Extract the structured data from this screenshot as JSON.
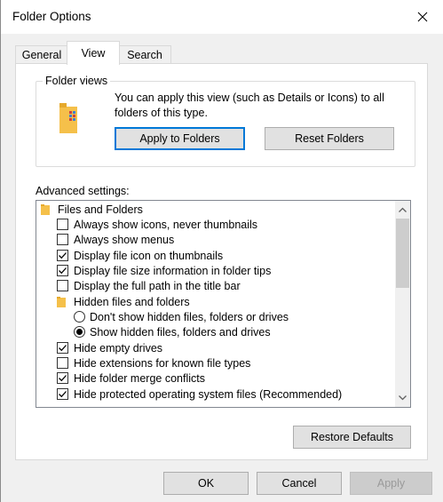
{
  "window": {
    "title": "Folder Options"
  },
  "tabs": [
    {
      "label": "General"
    },
    {
      "label": "View"
    },
    {
      "label": "Search"
    }
  ],
  "folder_views": {
    "label": "Folder views",
    "description": "You can apply this view (such as Details or Icons) to all folders of this type.",
    "apply_button": "Apply to Folders",
    "reset_button": "Reset Folders"
  },
  "advanced": {
    "label": "Advanced settings:",
    "items": [
      {
        "type": "folder",
        "label": "Files and Folders"
      },
      {
        "type": "checkbox",
        "label": "Always show icons, never thumbnails",
        "checked": false
      },
      {
        "type": "checkbox",
        "label": "Always show menus",
        "checked": false
      },
      {
        "type": "checkbox",
        "label": "Display file icon on thumbnails",
        "checked": true
      },
      {
        "type": "checkbox",
        "label": "Display file size information in folder tips",
        "checked": true
      },
      {
        "type": "checkbox",
        "label": "Display the full path in the title bar",
        "checked": false
      },
      {
        "type": "folder",
        "label": "Hidden files and folders"
      },
      {
        "type": "radio",
        "label": "Don't show hidden files, folders or drives",
        "checked": false
      },
      {
        "type": "radio",
        "label": "Show hidden files, folders and drives",
        "checked": true
      },
      {
        "type": "checkbox",
        "label": "Hide empty drives",
        "checked": true
      },
      {
        "type": "checkbox",
        "label": "Hide extensions for known file types",
        "checked": false
      },
      {
        "type": "checkbox",
        "label": "Hide folder merge conflicts",
        "checked": true
      },
      {
        "type": "checkbox",
        "label": "Hide protected operating system files (Recommended)",
        "checked": true
      }
    ],
    "restore_button": "Restore Defaults"
  },
  "footer": {
    "ok": "OK",
    "cancel": "Cancel",
    "apply": "Apply"
  },
  "colors": {
    "accent": "#0078d7",
    "folder": "#f5c04a",
    "button_face": "#e1e1e1"
  },
  "icons": {
    "close": "close-icon",
    "folder": "folder-icon",
    "scroll_up": "chevron-up-icon",
    "scroll_down": "chevron-down-icon"
  }
}
